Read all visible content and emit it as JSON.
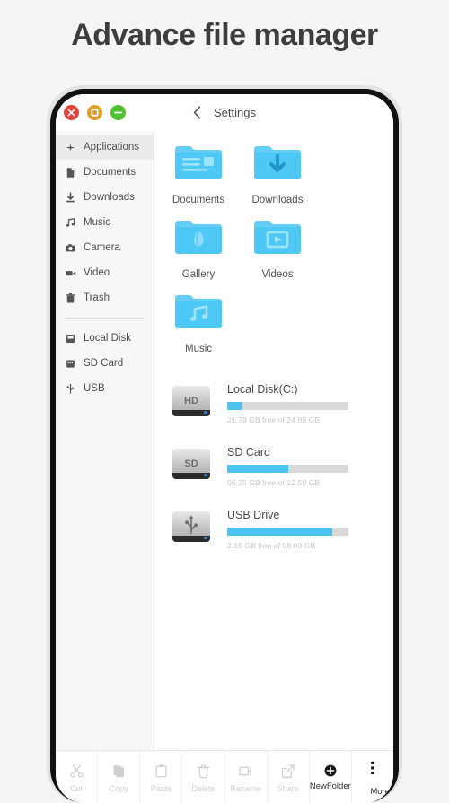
{
  "page": {
    "title": "Advance file manager"
  },
  "window": {
    "controls": [
      {
        "name": "close",
        "glyph": "close-icon",
        "color": "#e0443e"
      },
      {
        "name": "minimize",
        "glyph": "stop-icon",
        "color": "#dea123"
      },
      {
        "name": "zoom",
        "glyph": "minus-icon",
        "color": "#51c22e"
      }
    ],
    "nav": {
      "back_icon": "chevron-left-icon",
      "title": "Settings"
    }
  },
  "sidebar": {
    "group1": [
      {
        "label": "Applications",
        "icon": "applications-icon",
        "selected": true
      },
      {
        "label": "Documents",
        "icon": "document-icon",
        "selected": false
      },
      {
        "label": "Downloads",
        "icon": "download-icon",
        "selected": false
      },
      {
        "label": "Music",
        "icon": "music-note-icon",
        "selected": false
      },
      {
        "label": "Camera",
        "icon": "camera-icon",
        "selected": false
      },
      {
        "label": "Video",
        "icon": "video-camera-icon",
        "selected": false
      },
      {
        "label": "Trash",
        "icon": "trash-icon",
        "selected": false
      }
    ],
    "group2": [
      {
        "label": "Local Disk",
        "icon": "hard-disk-icon",
        "selected": false
      },
      {
        "label": "SD Card",
        "icon": "sd-card-icon",
        "selected": false
      },
      {
        "label": "USB",
        "icon": "usb-icon",
        "selected": false
      }
    ]
  },
  "main": {
    "folders": [
      {
        "label": "Documents",
        "icon": "folder-documents-icon"
      },
      {
        "label": "Downloads",
        "icon": "folder-downloads-icon"
      },
      {
        "label": "Gallery",
        "icon": "folder-gallery-icon"
      },
      {
        "label": "Videos",
        "icon": "folder-videos-icon"
      },
      {
        "label": "Music",
        "icon": "folder-music-icon"
      }
    ],
    "drives": [
      {
        "name": "Local Disk(C:)",
        "badge": "HD",
        "icon": "hard-drive-icon",
        "usage_text": "21.78 GB free of 24.89 GB",
        "used_percent": 12
      },
      {
        "name": "SD Card",
        "badge": "SD",
        "icon": "sd-drive-icon",
        "usage_text": "06.25 GB free of 12.50 GB",
        "used_percent": 50
      },
      {
        "name": "USB Drive",
        "badge": "",
        "icon": "usb-drive-icon",
        "usage_text": "2.15 GB free of 08.00 GB",
        "used_percent": 87
      }
    ],
    "bar_fill_color": "#4cc3f0",
    "bar_track_color": "#d9d9d9",
    "folder_color": "#4ec8f5"
  },
  "toolbar": [
    {
      "label": "Cut",
      "icon": "scissors-icon",
      "enabled": false
    },
    {
      "label": "Copy",
      "icon": "copy-icon",
      "enabled": false
    },
    {
      "label": "Paste",
      "icon": "paste-icon",
      "enabled": false
    },
    {
      "label": "Delete",
      "icon": "trash-icon",
      "enabled": false
    },
    {
      "label": "Rename",
      "icon": "rename-icon",
      "enabled": false
    },
    {
      "label": "Share",
      "icon": "share-icon",
      "enabled": false
    },
    {
      "label": "NewFolder",
      "icon": "plus-circle-icon",
      "enabled": true
    },
    {
      "label": "More",
      "icon": "more-vertical-icon",
      "enabled": true
    }
  ]
}
